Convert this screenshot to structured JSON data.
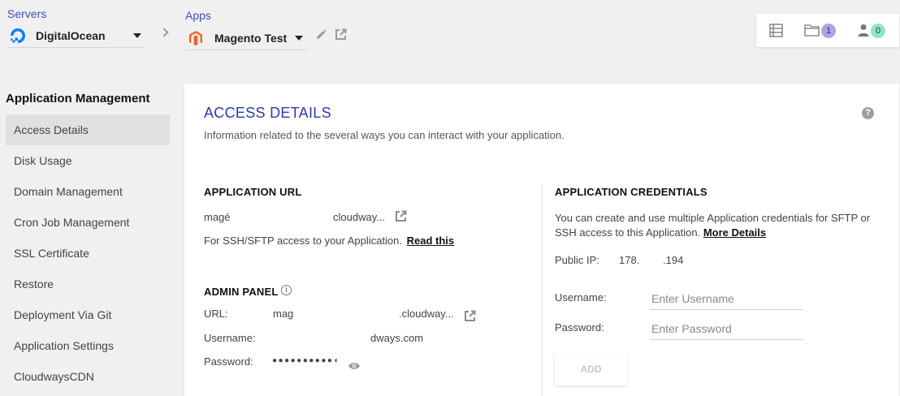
{
  "topbar": {
    "servers_label": "Servers",
    "server_name": "DigitalOcean",
    "apps_label": "Apps",
    "app_name": "Magento Test",
    "files_count": "1",
    "users_count": "0"
  },
  "sidebar": {
    "title": "Application Management",
    "items": [
      {
        "label": "Access Details"
      },
      {
        "label": "Disk Usage"
      },
      {
        "label": "Domain Management"
      },
      {
        "label": "Cron Job Management"
      },
      {
        "label": "SSL Certificate"
      },
      {
        "label": "Restore"
      },
      {
        "label": "Deployment Via Git"
      },
      {
        "label": "Application Settings"
      },
      {
        "label": "CloudwaysCDN"
      }
    ]
  },
  "main": {
    "title": "ACCESS DETAILS",
    "subtitle": "Information related to the several ways you can interact with your application.",
    "app_url": {
      "heading": "APPLICATION URL",
      "url_start": "magé",
      "url_end": "cloudway...",
      "ssh_text": "For SSH/SFTP access to your Application.",
      "ssh_link": "Read this"
    },
    "admin_panel": {
      "heading": "ADMIN PANEL",
      "url_label": "URL:",
      "url_start": "mag",
      "url_end": ".cloudway...",
      "username_label": "Username:",
      "username_value": "dways.com",
      "password_label": "Password:",
      "password_value": "●●●●●●●●●●◖"
    },
    "credentials": {
      "heading": "APPLICATION CREDENTIALS",
      "desc": "You can create and use multiple Application credentials for SFTP or SSH access to this Application.",
      "desc_link": "More Details",
      "public_ip_label": "Public IP:",
      "public_ip_a": "178.",
      "public_ip_b": ".194",
      "username_label": "Username:",
      "username_placeholder": "Enter Username",
      "password_label": "Password:",
      "password_placeholder": "Enter Password",
      "add_button": "ADD"
    }
  },
  "colors": {
    "accent": "#2f3aa7",
    "label_blue": "#3f51b5",
    "badge_files": "#a9a6ec",
    "badge_users": "#8fe6c6",
    "magento_orange": "#f26322",
    "digitalocean_blue": "#0080ff"
  }
}
